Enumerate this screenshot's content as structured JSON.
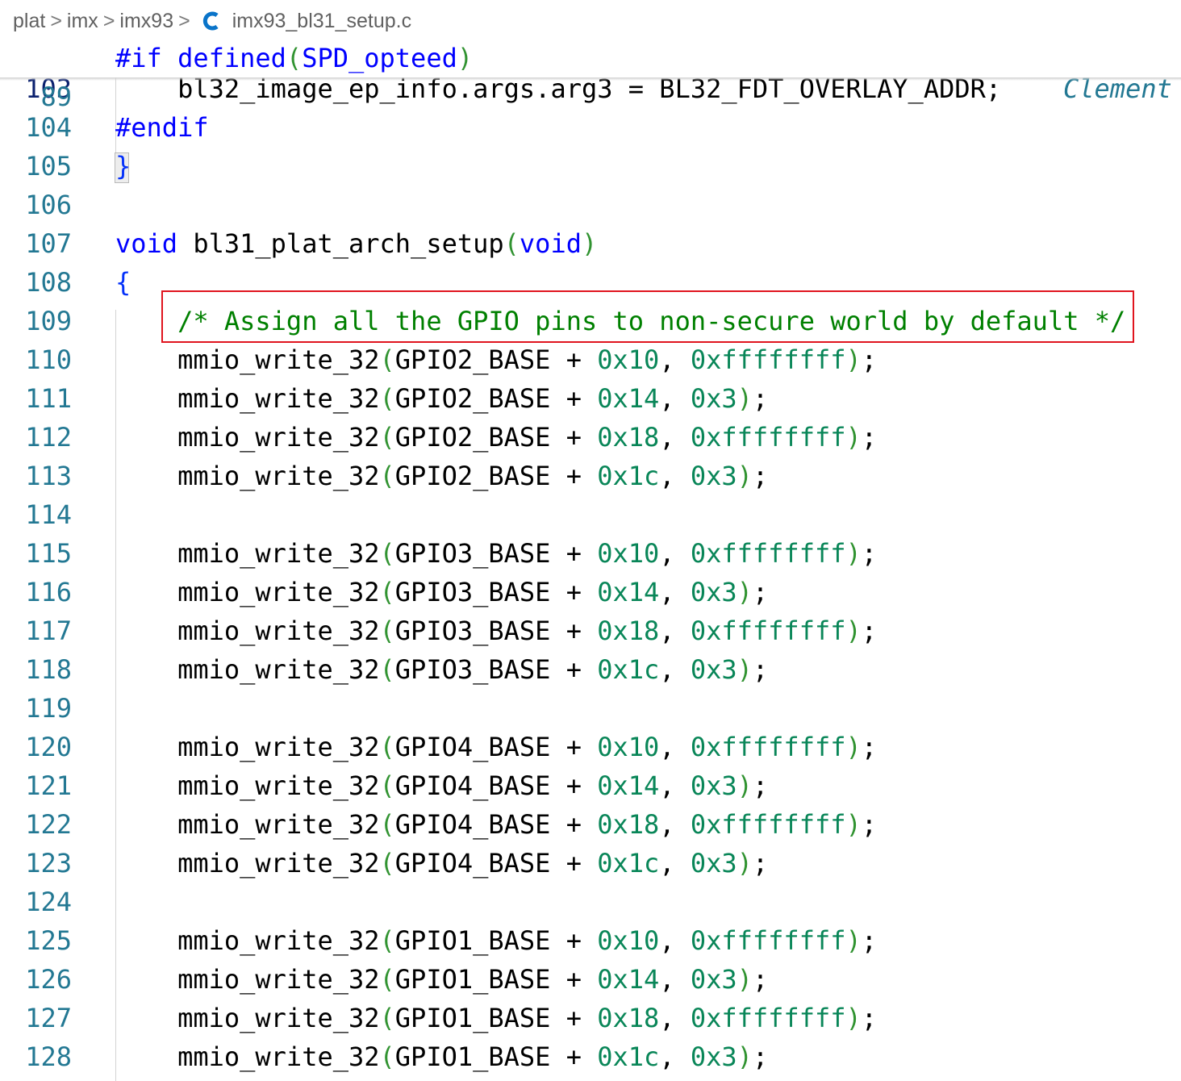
{
  "breadcrumb": {
    "items": [
      "plat",
      "imx",
      "imx93"
    ],
    "file_icon": "c-language-icon",
    "file": "imx93_bl31_setup.c",
    "separator": ">"
  },
  "sticky": {
    "line_number": "89",
    "directive": "#if",
    "operator": "defined",
    "open_paren": "(",
    "macro": "SPD_opteed",
    "close_paren": ")"
  },
  "lines": [
    {
      "n": "103",
      "code": "    bl32_image_ep_info.args.arg3 = BL32_FDT_OVERLAY_ADDR;",
      "blame": "Clement"
    },
    {
      "n": "104",
      "code": "#endif"
    },
    {
      "n": "105",
      "code": "}"
    },
    {
      "n": "106",
      "code": ""
    },
    {
      "n": "107",
      "code": "void bl31_plat_arch_setup(void)"
    },
    {
      "n": "108",
      "code": "{"
    },
    {
      "n": "109",
      "code": "    /* Assign all the GPIO pins to non-secure world by default */"
    },
    {
      "n": "110",
      "code": "    mmio_write_32(GPIO2_BASE + 0x10, 0xffffffff);"
    },
    {
      "n": "111",
      "code": "    mmio_write_32(GPIO2_BASE + 0x14, 0x3);"
    },
    {
      "n": "112",
      "code": "    mmio_write_32(GPIO2_BASE + 0x18, 0xffffffff);"
    },
    {
      "n": "113",
      "code": "    mmio_write_32(GPIO2_BASE + 0x1c, 0x3);"
    },
    {
      "n": "114",
      "code": ""
    },
    {
      "n": "115",
      "code": "    mmio_write_32(GPIO3_BASE + 0x10, 0xffffffff);"
    },
    {
      "n": "116",
      "code": "    mmio_write_32(GPIO3_BASE + 0x14, 0x3);"
    },
    {
      "n": "117",
      "code": "    mmio_write_32(GPIO3_BASE + 0x18, 0xffffffff);"
    },
    {
      "n": "118",
      "code": "    mmio_write_32(GPIO3_BASE + 0x1c, 0x3);"
    },
    {
      "n": "119",
      "code": ""
    },
    {
      "n": "120",
      "code": "    mmio_write_32(GPIO4_BASE + 0x10, 0xffffffff);"
    },
    {
      "n": "121",
      "code": "    mmio_write_32(GPIO4_BASE + 0x14, 0x3);"
    },
    {
      "n": "122",
      "code": "    mmio_write_32(GPIO4_BASE + 0x18, 0xffffffff);"
    },
    {
      "n": "123",
      "code": "    mmio_write_32(GPIO4_BASE + 0x1c, 0x3);"
    },
    {
      "n": "124",
      "code": ""
    },
    {
      "n": "125",
      "code": "    mmio_write_32(GPIO1_BASE + 0x10, 0xffffffff);"
    },
    {
      "n": "126",
      "code": "    mmio_write_32(GPIO1_BASE + 0x14, 0x3);"
    },
    {
      "n": "127",
      "code": "    mmio_write_32(GPIO1_BASE + 0x18, 0xffffffff);"
    },
    {
      "n": "128",
      "code": "    mmio_write_32(GPIO1_BASE + 0x1c, 0x3);"
    }
  ],
  "colors": {
    "line_number": "#237893",
    "active_line_number": "#0b216f",
    "keyword": "#0000ff",
    "number": "#098658",
    "comment": "#008000",
    "bracket_level1": "#0431fa",
    "bracket_level2": "#319331",
    "highlight_border": "#e0141e"
  }
}
